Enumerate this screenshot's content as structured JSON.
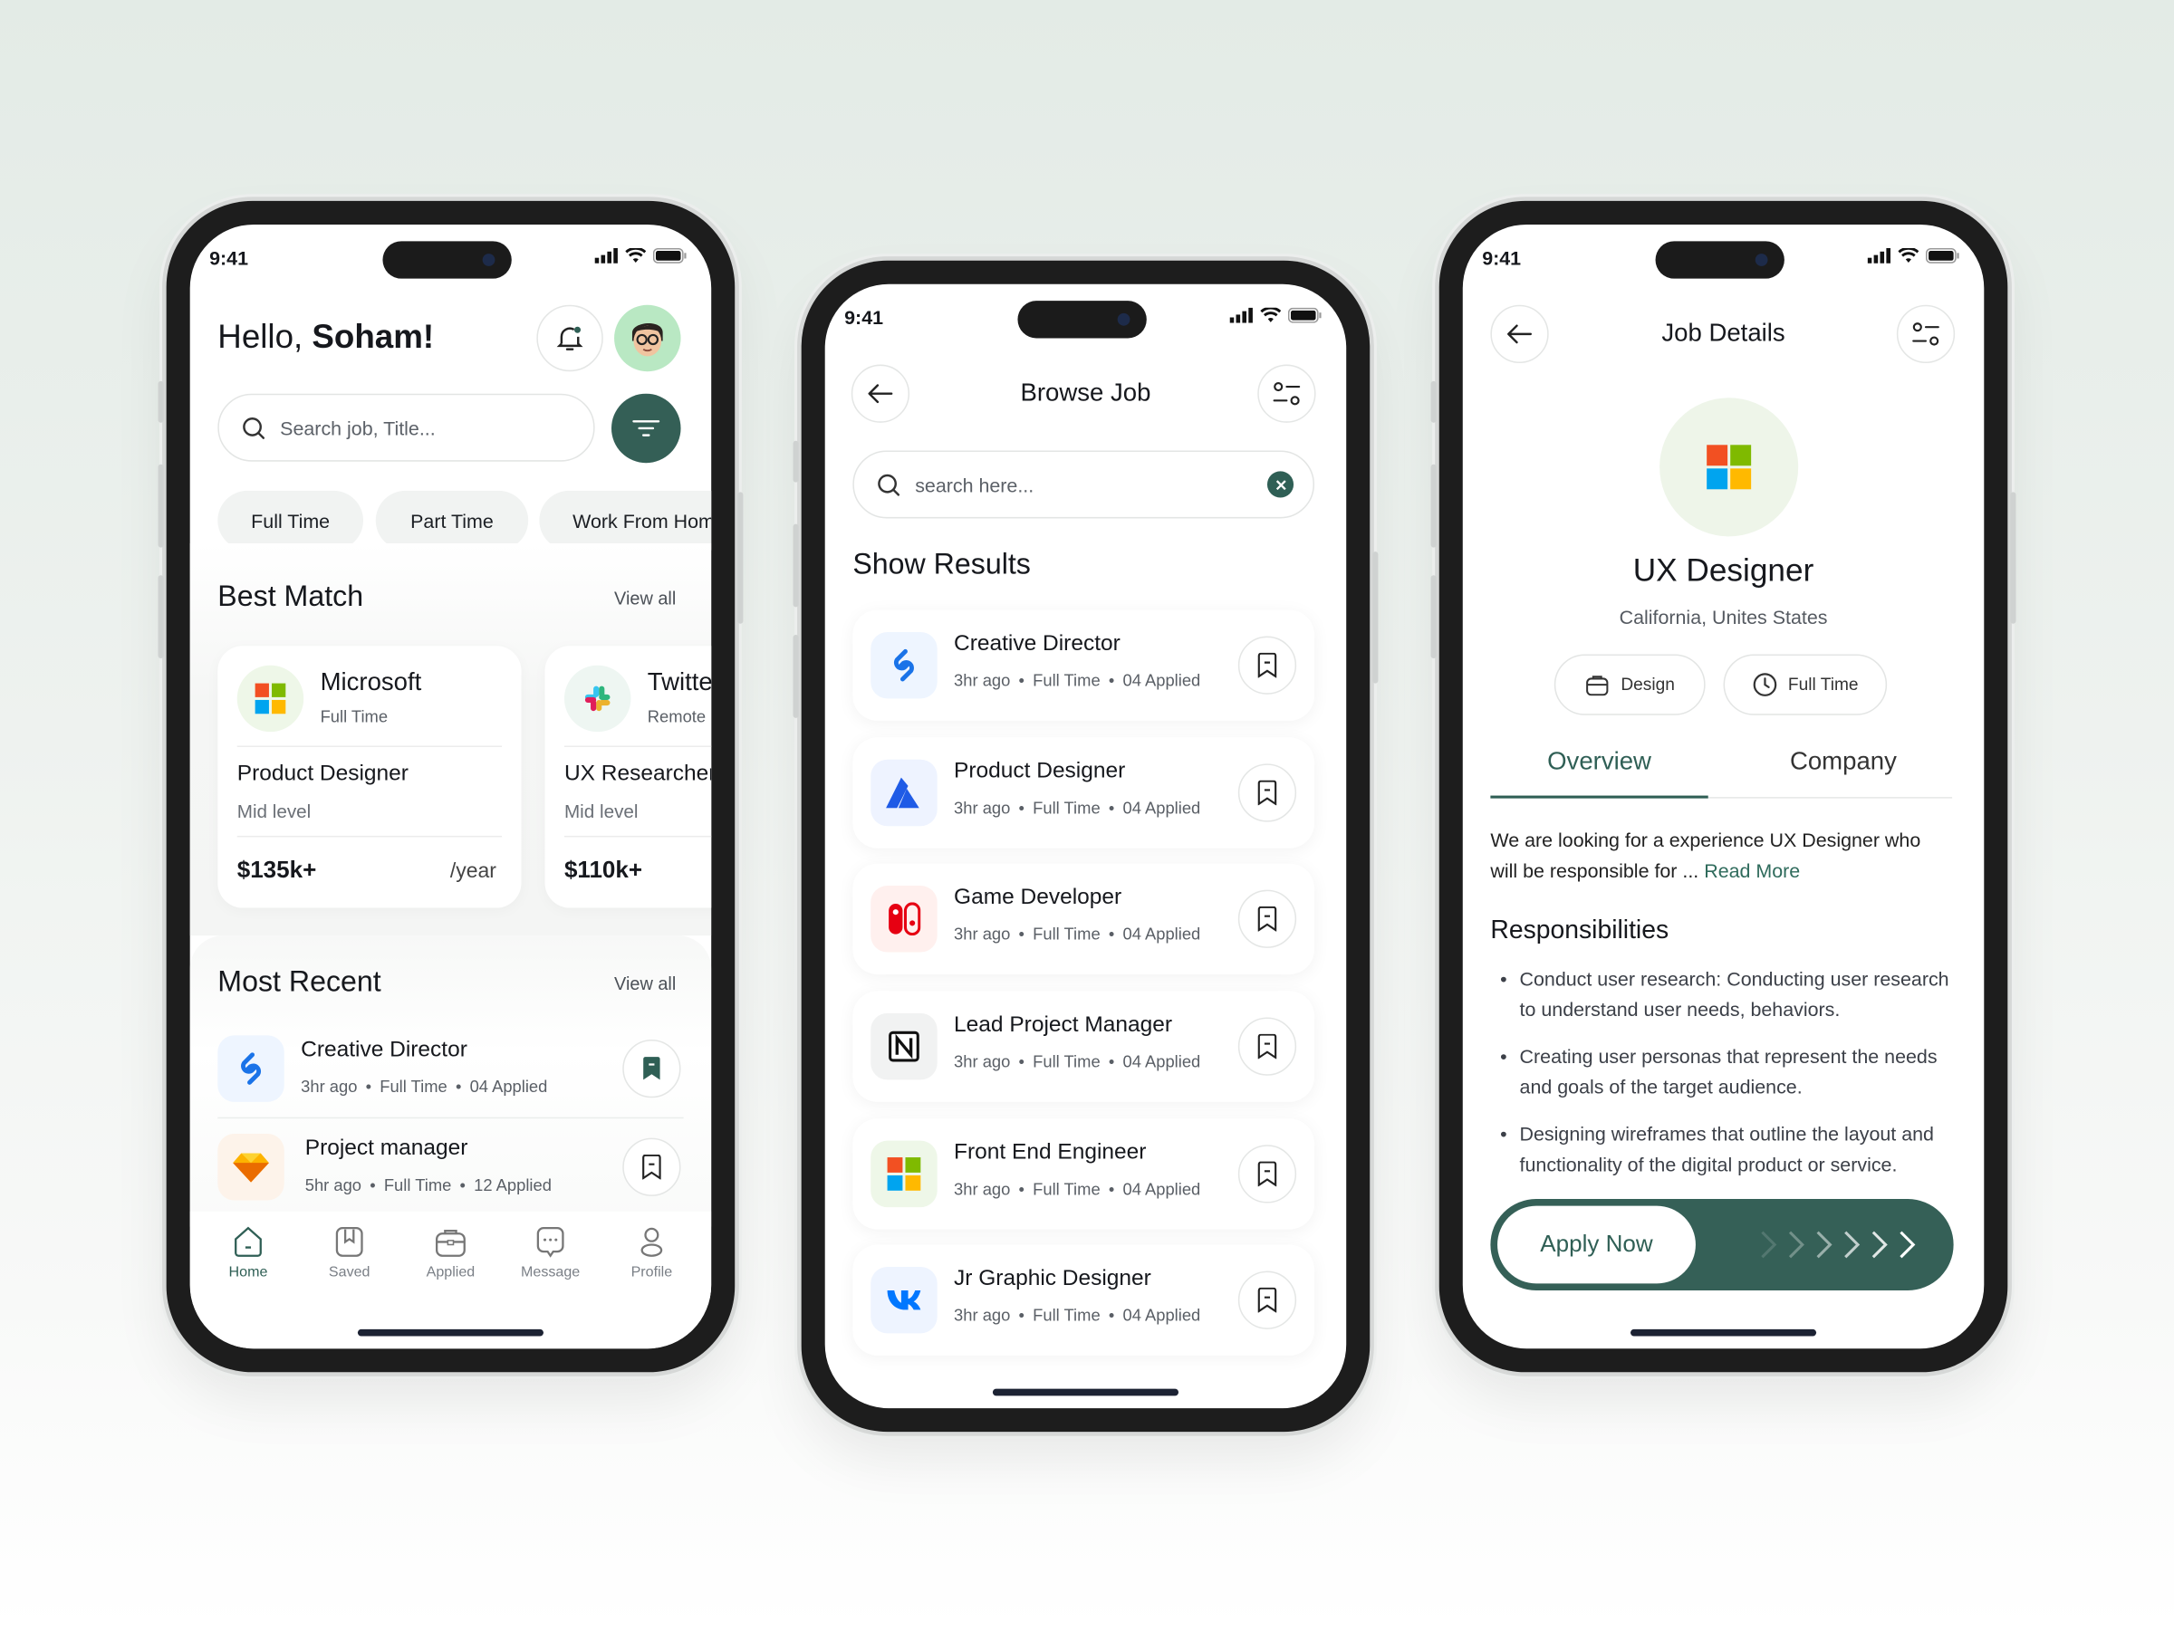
{
  "colors": {
    "primary": "#2f5f55",
    "background": "#e6ece8",
    "accent_text": "#2f6b5c"
  },
  "status": {
    "time": "9:41"
  },
  "home": {
    "greeting": "Hello,",
    "name": "Soham!",
    "search_placeholder": "Search job, Title...",
    "chips": [
      "Full Time",
      "Part Time",
      "Work From Home"
    ],
    "best_match": {
      "title": "Best Match",
      "view_all": "View all",
      "cards": [
        {
          "company": "Microsoft",
          "type": "Full Time",
          "role": "Product Designer",
          "level": "Mid level",
          "salary": "$135k+",
          "period": "/year",
          "logo": "microsoft-logo"
        },
        {
          "company": "Twitter",
          "type": "Remote",
          "role": "UX Researcher",
          "level": "Mid level",
          "salary": "$110k+",
          "logo": "slack-logo"
        }
      ]
    },
    "most_recent": {
      "title": "Most Recent",
      "view_all": "View all",
      "items": [
        {
          "title": "Creative Director",
          "time": "3hr ago",
          "type": "Full Time",
          "applied": "04 Applied",
          "logo": "shazam-logo",
          "saved": true
        },
        {
          "title": "Project manager",
          "time": "5hr ago",
          "type": "Full Time",
          "applied": "12 Applied",
          "logo": "sketch-logo",
          "saved": false
        }
      ]
    },
    "nav": [
      {
        "label": "Home",
        "icon": "home-icon",
        "active": true
      },
      {
        "label": "Saved",
        "icon": "bookmark-icon"
      },
      {
        "label": "Applied",
        "icon": "briefcase-icon"
      },
      {
        "label": "Message",
        "icon": "message-icon"
      },
      {
        "label": "Profile",
        "icon": "user-icon"
      }
    ]
  },
  "browse": {
    "title": "Browse Job",
    "search_placeholder": "search here...",
    "results_title": "Show Results",
    "items": [
      {
        "title": "Creative Director",
        "time": "3hr ago",
        "type": "Full Time",
        "applied": "04 Applied",
        "logo": "shazam-logo"
      },
      {
        "title": "Product Designer",
        "time": "3hr ago",
        "type": "Full Time",
        "applied": "04 Applied",
        "logo": "triangle-logo"
      },
      {
        "title": "Game Developer",
        "time": "3hr ago",
        "type": "Full Time",
        "applied": "04 Applied",
        "logo": "nintendo-switch-logo"
      },
      {
        "title": "Lead Project Manager",
        "time": "3hr ago",
        "type": "Full Time",
        "applied": "04 Applied",
        "logo": "notion-logo"
      },
      {
        "title": "Front End Engineer",
        "time": "3hr ago",
        "type": "Full Time",
        "applied": "04 Applied",
        "logo": "microsoft-logo"
      },
      {
        "title": "Jr Graphic Designer",
        "time": "3hr ago",
        "type": "Full Time",
        "applied": "04 Applied",
        "logo": "vk-logo"
      }
    ]
  },
  "details": {
    "title": "Job Details",
    "role": "UX Designer",
    "location": "California, Unites States",
    "tags": [
      {
        "label": "Design",
        "icon": "briefcase-icon"
      },
      {
        "label": "Full Time",
        "icon": "clock-icon"
      }
    ],
    "tabs": [
      {
        "label": "Overview",
        "active": true
      },
      {
        "label": "Company",
        "active": false
      }
    ],
    "description": "We are looking for a experience UX Designer who will be responsible for ...",
    "read_more": "Read More",
    "responsibilities_title": "Responsibilities",
    "responsibilities": [
      "Conduct user research: Conducting user research to understand user needs, behaviors.",
      "Creating user personas that represent the needs and goals of the target audience.",
      "Designing wireframes that outline the layout and functionality of the digital product or service."
    ],
    "apply_label": "Apply Now"
  }
}
